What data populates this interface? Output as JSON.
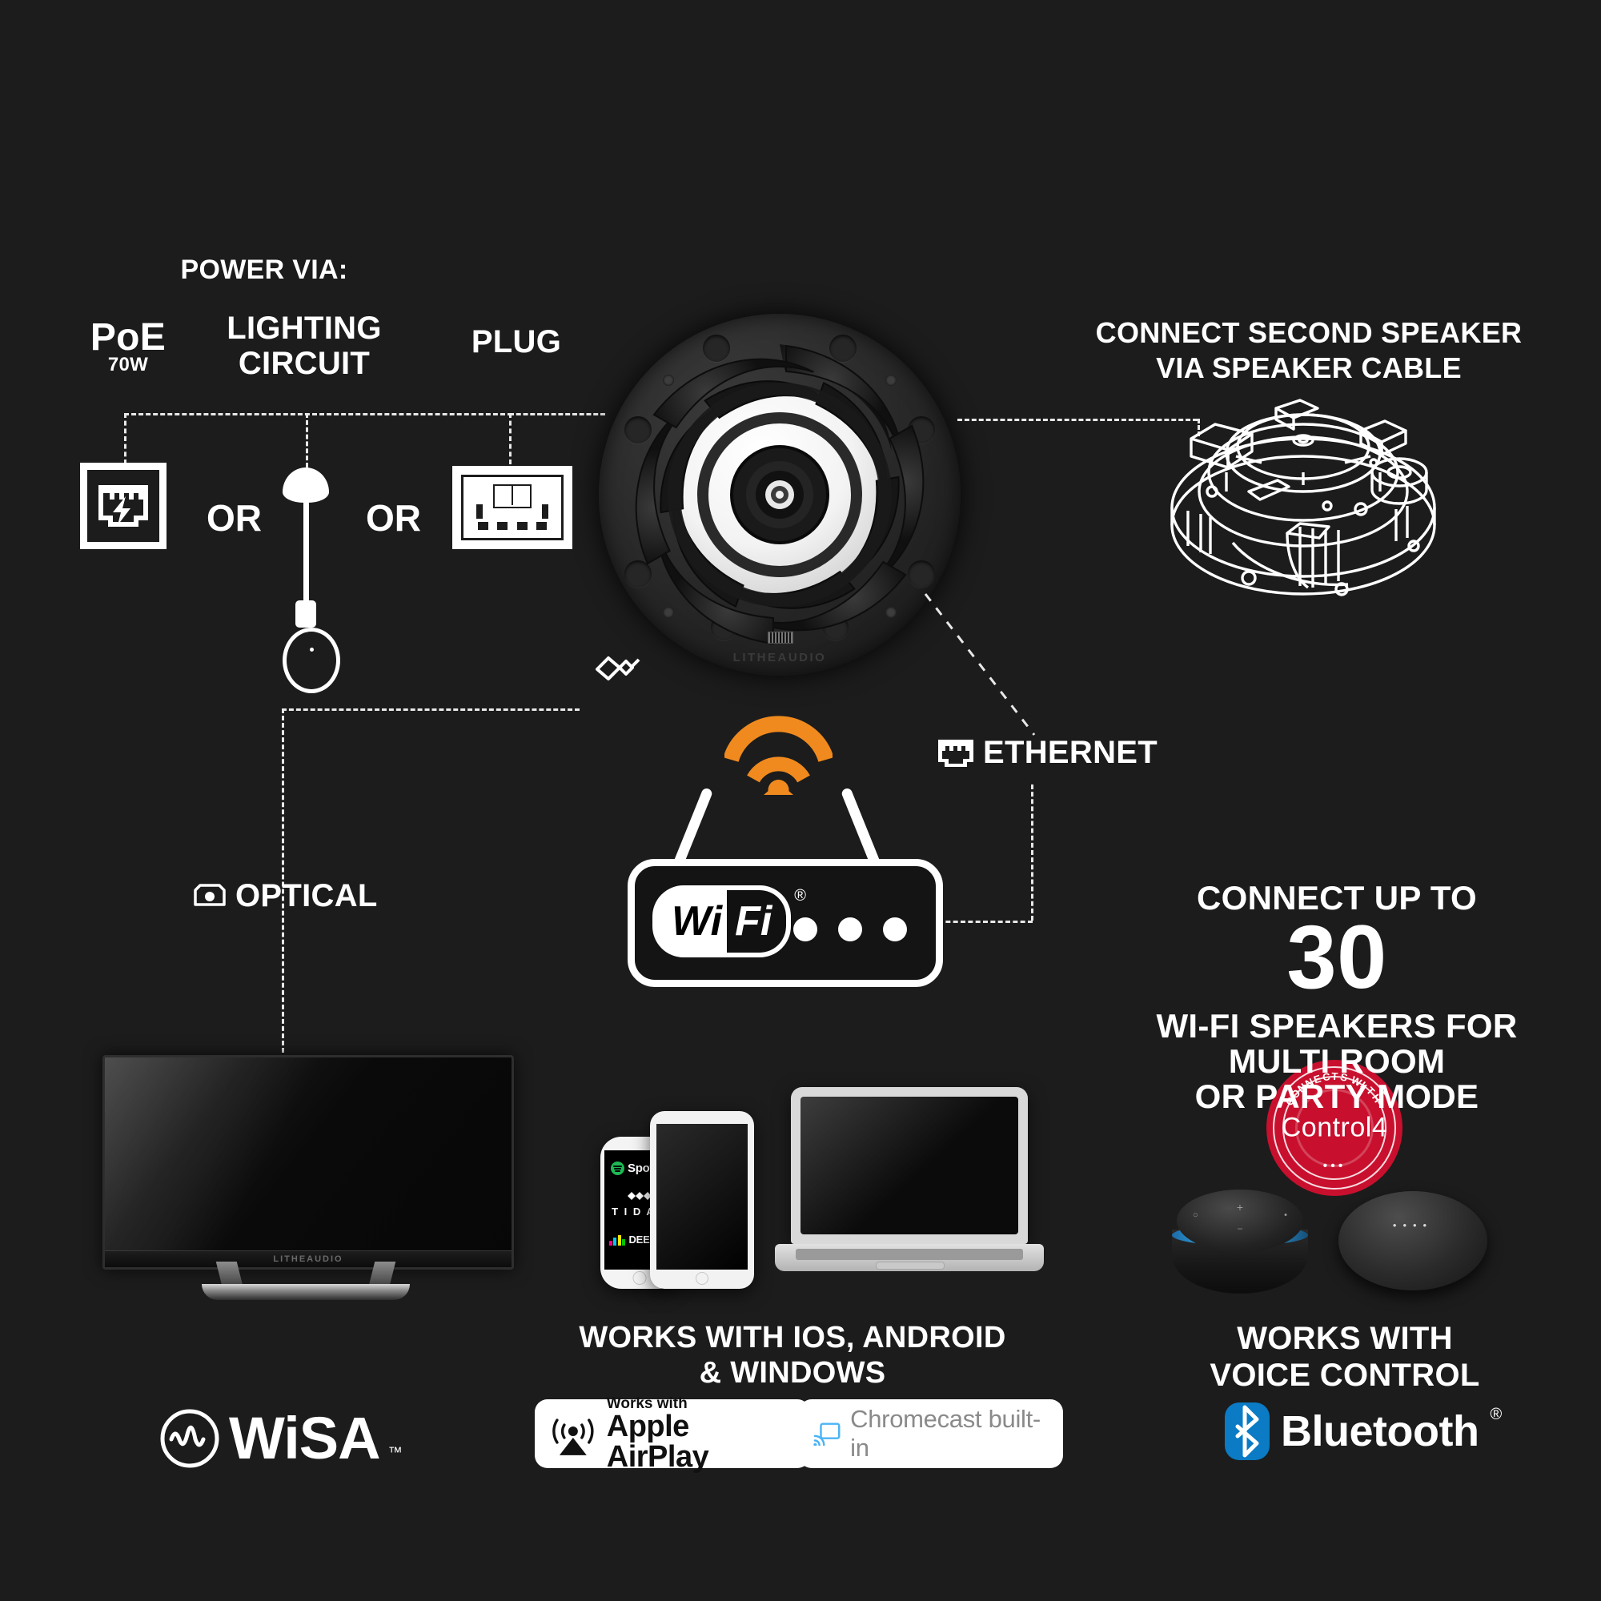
{
  "meta": {
    "background_color": "#1c1c1c",
    "accent_orange": "#F08A1E",
    "accent_red": "#C8102E",
    "accent_blue": "#0A7BC4",
    "cast_blue": "#4CB4F5"
  },
  "power": {
    "heading": "POWER VIA:",
    "options": [
      {
        "label": "PoE",
        "sub": "70W",
        "icon": "poe-rj45-lightning-icon"
      },
      {
        "label": "LIGHTING\nCIRCUIT",
        "line1": "LIGHTING",
        "line2": "CIRCUIT",
        "icon": "pendant-light-icon"
      },
      {
        "label": "PLUG",
        "icon": "uk-wall-socket-icon"
      }
    ],
    "separator": "OR"
  },
  "speaker": {
    "brand": "LITHEAUDIO",
    "name": "ceiling-speaker"
  },
  "second_speaker": {
    "caption_line1": "CONNECT SECOND SPEAKER",
    "caption_line2": "VIA SPEAKER CABLE"
  },
  "connections": {
    "optical": {
      "label": "OPTICAL",
      "icon": "optical-toslink-icon"
    },
    "ethernet": {
      "label": "ETHERNET",
      "icon": "rj45-ethernet-icon"
    },
    "wifi": {
      "logo_left": "Wi",
      "logo_right": "Fi",
      "registered": "®"
    },
    "jack": {
      "icon": "audio-jack-plug-icon"
    }
  },
  "control4": {
    "arc_text": "CONNECTS WITH",
    "word": "Control4",
    "dots": "•••"
  },
  "multiroom": {
    "line1": "CONNECT UP TO",
    "count": "30",
    "line2": "WI-FI SPEAKERS FOR",
    "line3": "MULTI ROOM",
    "line4": "OR PARTY MODE"
  },
  "tv": {
    "brand": "LITHEAUDIO"
  },
  "devices": {
    "caption_line1": "WORKS WITH IOS, ANDROID",
    "caption_line2": "& WINDOWS",
    "services": [
      {
        "name": "Spotify",
        "label": "Spotify"
      },
      {
        "name": "Tidal",
        "label": "T I D A L"
      },
      {
        "name": "Deezer",
        "label": "DEEZER"
      }
    ]
  },
  "voice": {
    "caption_line1": "WORKS WITH",
    "caption_line2": "VOICE CONTROL",
    "assistants": [
      {
        "name": "amazon-echo-dot"
      },
      {
        "name": "google-nest-mini",
        "dots": "••••"
      }
    ]
  },
  "logos": {
    "wisa": {
      "word": "WiSA",
      "tm": "™"
    },
    "airplay": {
      "line1": "Works with",
      "line2": "Apple AirPlay"
    },
    "chromecast": {
      "label": "Chromecast built-in"
    },
    "bluetooth": {
      "word": "Bluetooth",
      "registered": "®"
    }
  }
}
